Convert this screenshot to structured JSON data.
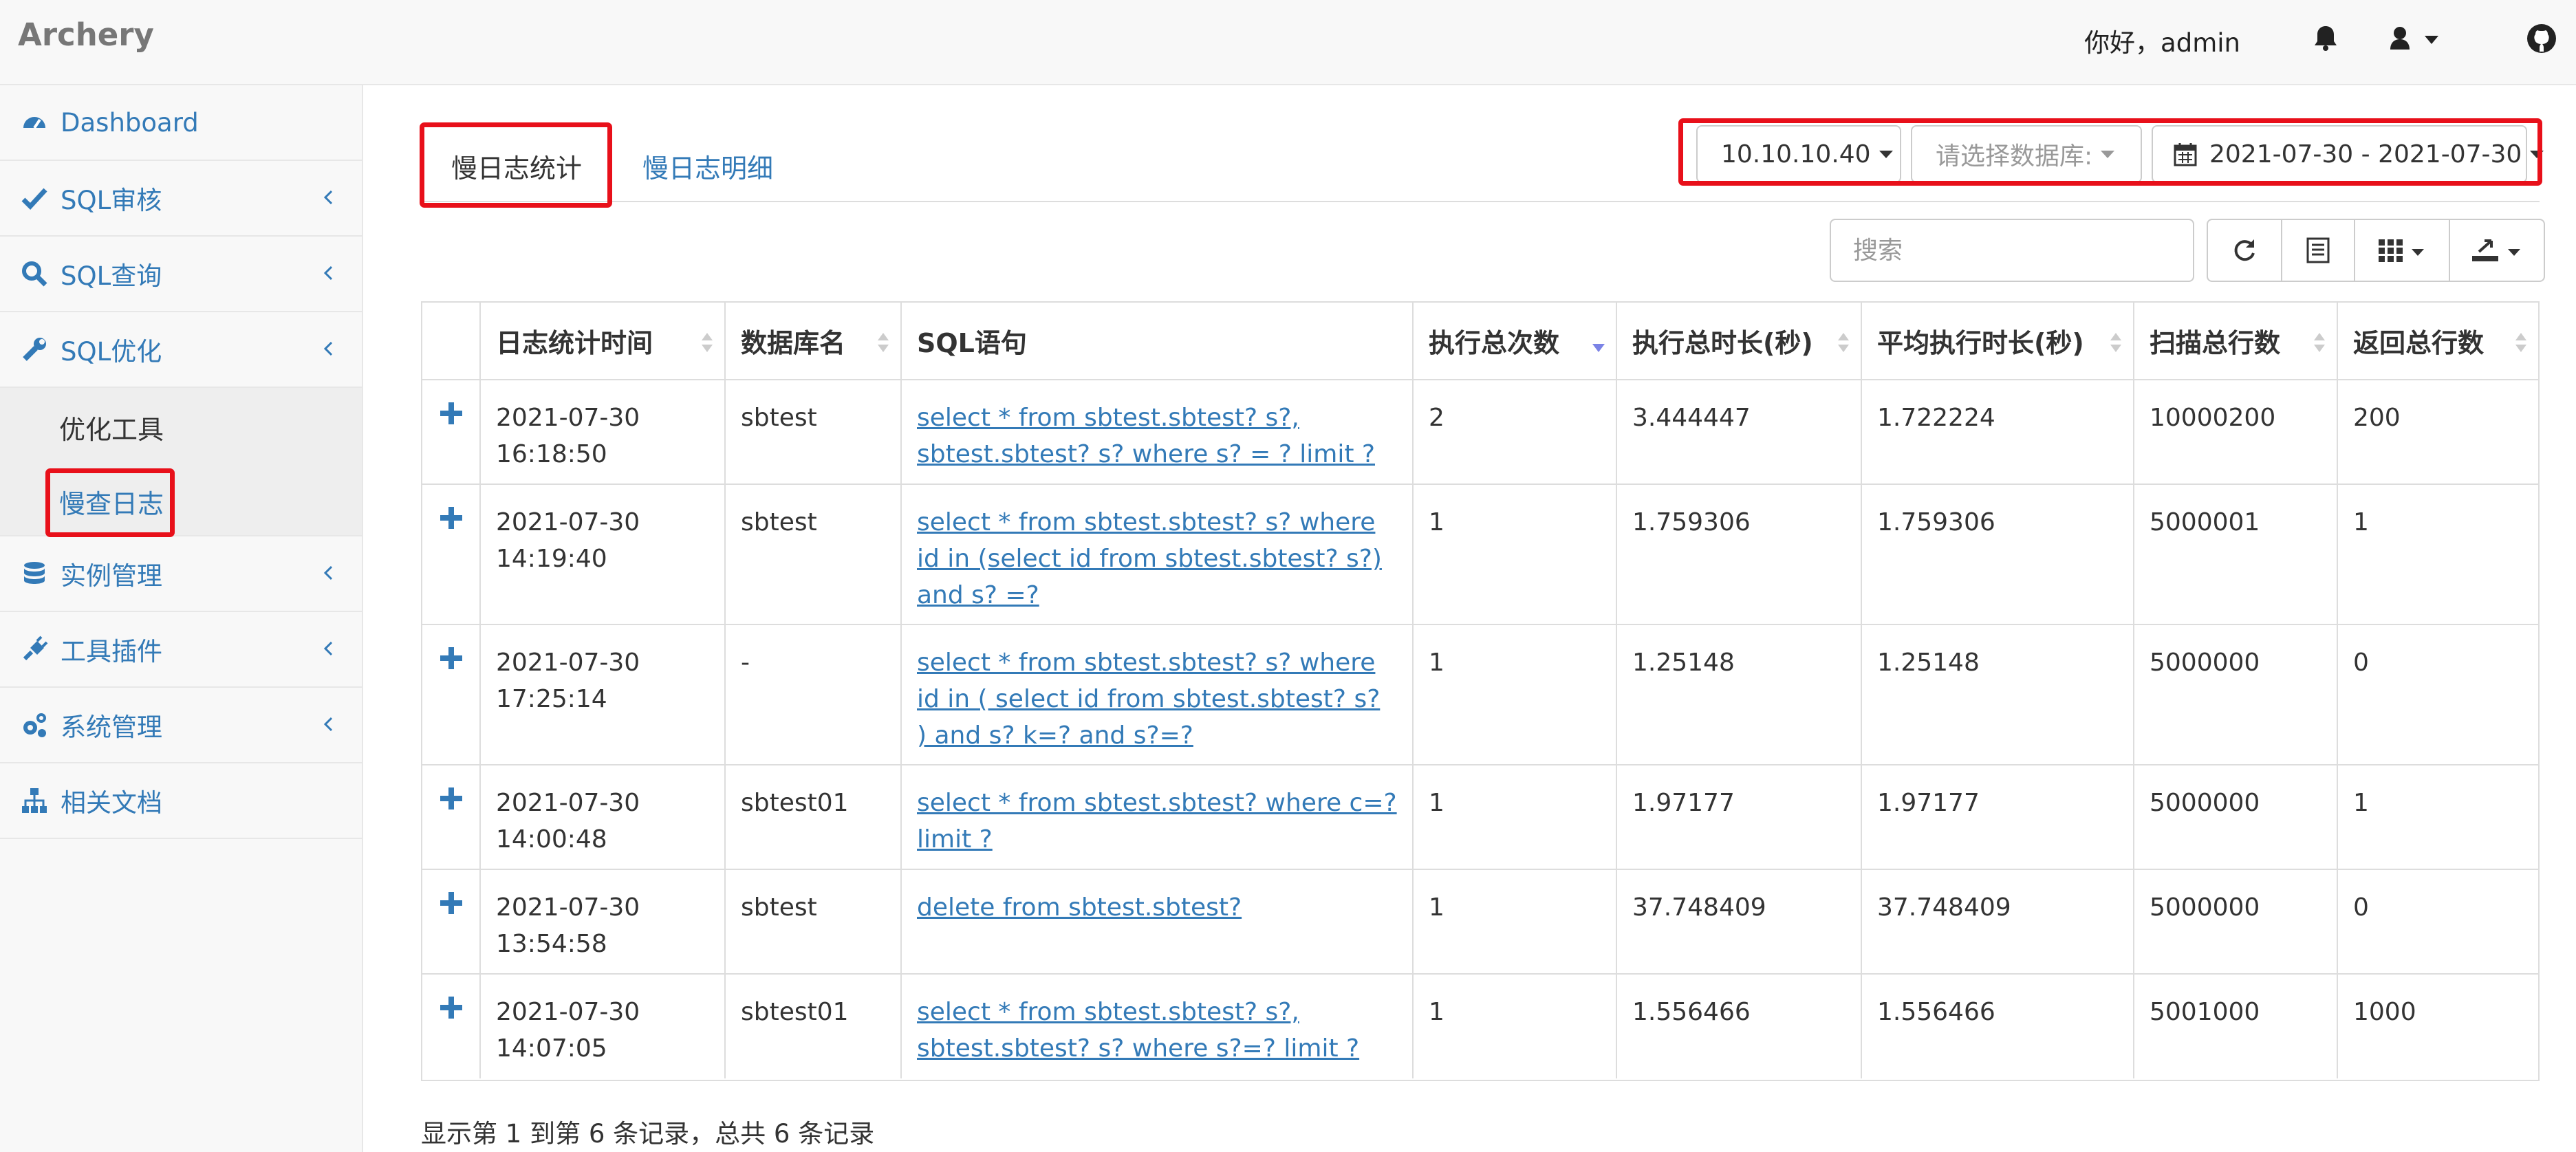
{
  "app": {
    "brand": "Archery"
  },
  "header": {
    "greeting": "你好，admin"
  },
  "sidebar": {
    "items": [
      {
        "label": "Dashboard",
        "icon": "dashboard-icon",
        "has_submenu": false
      },
      {
        "label": "SQL审核",
        "icon": "check-icon",
        "has_submenu": true
      },
      {
        "label": "SQL查询",
        "icon": "search-icon",
        "has_submenu": true
      },
      {
        "label": "SQL优化",
        "icon": "wrench-icon",
        "has_submenu": true
      }
    ],
    "sub_items": [
      {
        "label": "优化工具",
        "active": false
      },
      {
        "label": "慢查日志",
        "active": true
      }
    ],
    "items_after": [
      {
        "label": "实例管理",
        "icon": "database-icon",
        "has_submenu": true
      },
      {
        "label": "工具插件",
        "icon": "plug-icon",
        "has_submenu": true
      },
      {
        "label": "系统管理",
        "icon": "cogs-icon",
        "has_submenu": true
      },
      {
        "label": "相关文档",
        "icon": "sitemap-icon",
        "has_submenu": false
      }
    ]
  },
  "tabs": [
    {
      "label": "慢日志统计",
      "active": true
    },
    {
      "label": "慢日志明细",
      "active": false
    }
  ],
  "filters": {
    "instance": "10.10.10.40",
    "database_placeholder": "请选择数据库:",
    "date_range": "2021-07-30 - 2021-07-30"
  },
  "search": {
    "placeholder": "搜索"
  },
  "table": {
    "columns": [
      "日志统计时间",
      "数据库名",
      "SQL语句",
      "执行总次数",
      "执行总时长(秒)",
      "平均执行时长(秒)",
      "扫描总行数",
      "返回总行数"
    ],
    "rows": [
      {
        "time_date": "2021-07-30",
        "time_clock": "16:18:50",
        "db": "sbtest",
        "sql": "select * from sbtest.sbtest? s?, sbtest.sbtest? s? where s? = ? limit ?",
        "count": "2",
        "total": "3.444447",
        "avg": "1.722224",
        "scanned": "10000200",
        "returned": "200"
      },
      {
        "time_date": "2021-07-30",
        "time_clock": "14:19:40",
        "db": "sbtest",
        "sql": "select * from sbtest.sbtest? s? where id in (select id from sbtest.sbtest? s?) and s? =?",
        "count": "1",
        "total": "1.759306",
        "avg": "1.759306",
        "scanned": "5000001",
        "returned": "1"
      },
      {
        "time_date": "2021-07-30",
        "time_clock": "17:25:14",
        "db": "-",
        "sql": "select * from sbtest.sbtest? s? where id in ( select id from sbtest.sbtest? s? ) and s? k=? and s?=?",
        "count": "1",
        "total": "1.25148",
        "avg": "1.25148",
        "scanned": "5000000",
        "returned": "0"
      },
      {
        "time_date": "2021-07-30",
        "time_clock": "14:00:48",
        "db": "sbtest01",
        "sql": "select * from sbtest.sbtest? where c=? limit ?",
        "count": "1",
        "total": "1.97177",
        "avg": "1.97177",
        "scanned": "5000000",
        "returned": "1"
      },
      {
        "time_date": "2021-07-30",
        "time_clock": "13:54:58",
        "db": "sbtest",
        "sql": "delete from sbtest.sbtest?",
        "count": "1",
        "total": "37.748409",
        "avg": "37.748409",
        "scanned": "5000000",
        "returned": "0"
      },
      {
        "time_date": "2021-07-30",
        "time_clock": "14:07:05",
        "db": "sbtest01",
        "sql": "select * from sbtest.sbtest? s?, sbtest.sbtest? s? where s?=? limit ?",
        "count": "1",
        "total": "1.556466",
        "avg": "1.556466",
        "scanned": "5001000",
        "returned": "1000"
      }
    ]
  },
  "pagination": {
    "summary": "显示第 1 到第 6 条记录，总共 6 条记录"
  },
  "colors": {
    "link": "#337ab7",
    "highlight": "#e8101a",
    "sort_active": "#7b83e6"
  }
}
